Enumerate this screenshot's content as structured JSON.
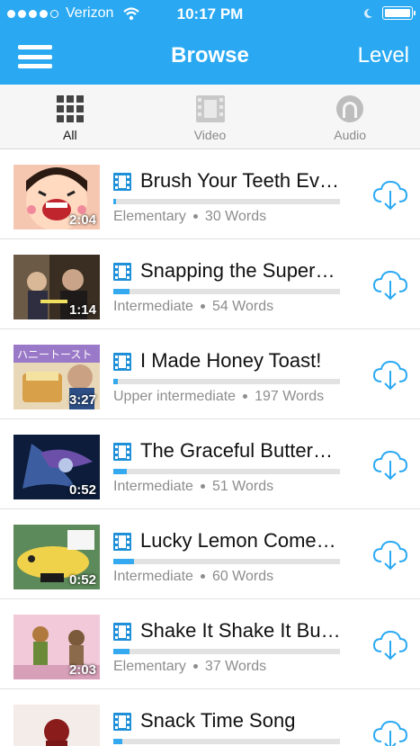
{
  "status": {
    "carrier": "Verizon",
    "time": "10:17 PM",
    "signal": "wifi-icon",
    "moon": "moon-icon",
    "battery_level": 1.0
  },
  "nav": {
    "title": "Browse",
    "right_label": "Level",
    "menu_icon": "hamburger-icon"
  },
  "tabs": [
    {
      "label": "All",
      "icon": "grid-icon",
      "active": true
    },
    {
      "label": "Video",
      "icon": "film-icon",
      "active": false
    },
    {
      "label": "Audio",
      "icon": "headphones-icon",
      "active": false
    }
  ],
  "colors": {
    "accent": "#2aa9f2",
    "progress": "#35a9ef",
    "video_badge": "#1f8fd8"
  },
  "items": [
    {
      "title": "Brush Your Teeth Ev…",
      "duration": "2:04",
      "level": "Elementary",
      "words": "30 Words",
      "progress": 0.01
    },
    {
      "title": "Snapping the Super…",
      "duration": "1:14",
      "level": "Intermediate",
      "words": "54 Words",
      "progress": 0.07
    },
    {
      "title": "I Made Honey Toast!",
      "duration": "3:27",
      "level": "Upper intermediate",
      "words": "197 Words",
      "progress": 0.02
    },
    {
      "title": "The Graceful Butter…",
      "duration": "0:52",
      "level": "Intermediate",
      "words": "51 Words",
      "progress": 0.06
    },
    {
      "title": "Lucky Lemon Come…",
      "duration": "0:52",
      "level": "Intermediate",
      "words": "60 Words",
      "progress": 0.09
    },
    {
      "title": "Shake It Shake It Bu…",
      "duration": "2:03",
      "level": "Elementary",
      "words": "37 Words",
      "progress": 0.07
    },
    {
      "title": "Snack Time Song",
      "duration": "",
      "level": "",
      "words": "",
      "progress": 0.04
    }
  ]
}
